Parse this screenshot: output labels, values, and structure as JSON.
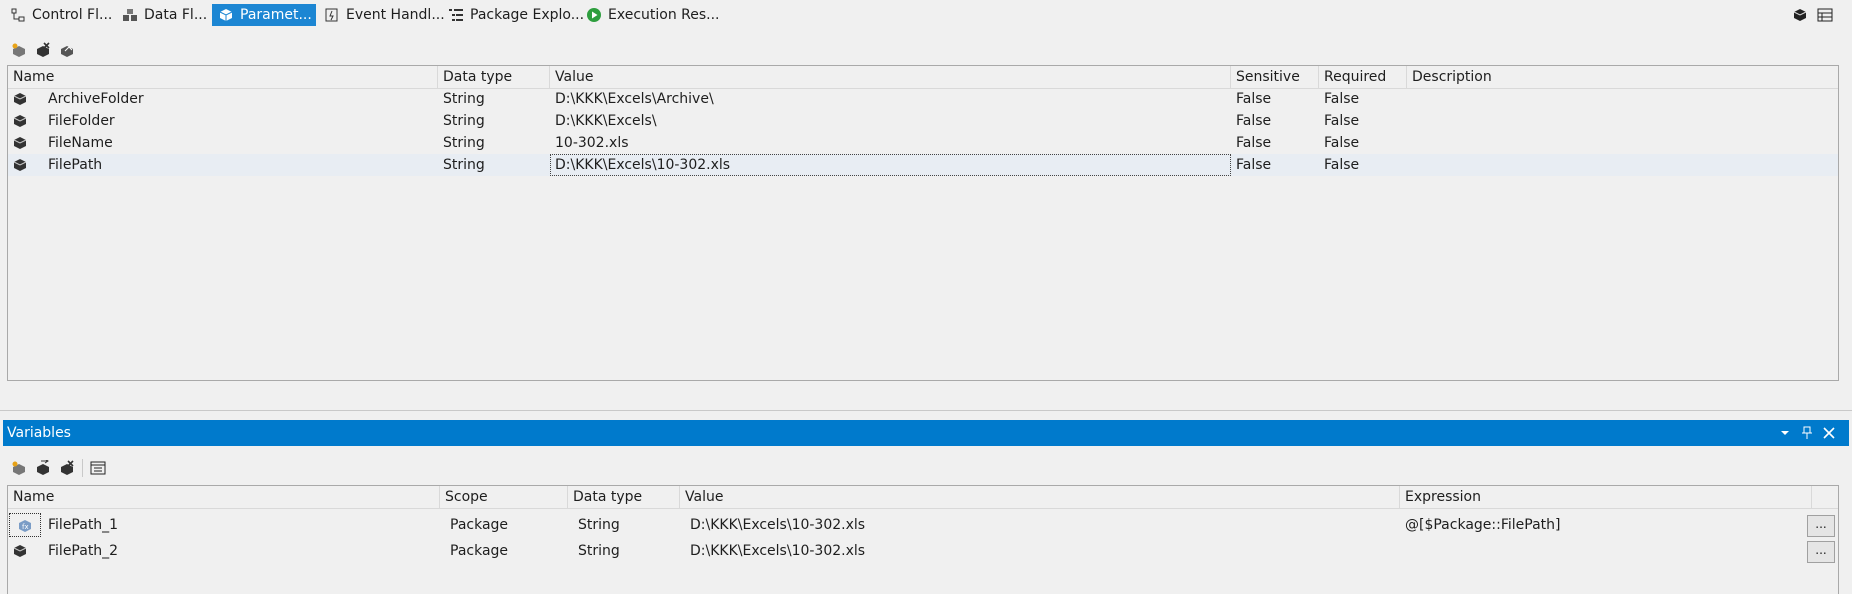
{
  "tabs": [
    {
      "label": "Control Fl...",
      "icon": "control-flow-icon",
      "active": false
    },
    {
      "label": "Data Fl...",
      "icon": "data-flow-icon",
      "active": false
    },
    {
      "label": "Paramet...",
      "icon": "parameters-icon",
      "active": true
    },
    {
      "label": "Event Handl...",
      "icon": "event-handlers-icon",
      "active": false
    },
    {
      "label": "Package Explo...",
      "icon": "package-explorer-icon",
      "active": false
    },
    {
      "label": "Execution Res...",
      "icon": "execution-results-icon",
      "active": false
    }
  ],
  "parameters": {
    "columns": [
      "Name",
      "Data type",
      "Value",
      "Sensitive",
      "Required",
      "Description"
    ],
    "rows": [
      {
        "name": "ArchiveFolder",
        "data_type": "String",
        "value": "D:\\KKK\\Excels\\Archive\\",
        "sensitive": "False",
        "required": "False",
        "description": ""
      },
      {
        "name": "FileFolder",
        "data_type": "String",
        "value": "D:\\KKK\\Excels\\",
        "sensitive": "False",
        "required": "False",
        "description": ""
      },
      {
        "name": "FileName",
        "data_type": "String",
        "value": "10-302.xls",
        "sensitive": "False",
        "required": "False",
        "description": ""
      },
      {
        "name": "FilePath",
        "data_type": "String",
        "value": "D:\\KKK\\Excels\\10-302.xls",
        "sensitive": "False",
        "required": "False",
        "description": ""
      }
    ]
  },
  "variables": {
    "title": "Variables",
    "columns": [
      "Name",
      "Scope",
      "Data type",
      "Value",
      "Expression"
    ],
    "rows": [
      {
        "name": "FilePath_1",
        "scope": "Package",
        "data_type": "String",
        "value": "D:\\KKK\\Excels\\10-302.xls",
        "expression": "@[$Package::FilePath]",
        "ellipsis": "..."
      },
      {
        "name": "FilePath_2",
        "scope": "Package",
        "data_type": "String",
        "value": "D:\\KKK\\Excels\\10-302.xls",
        "expression": "",
        "ellipsis": "..."
      }
    ]
  },
  "colors": {
    "accent": "#007acc",
    "active_tab": "#1c86d3",
    "selected_row": "#e8edf3"
  }
}
